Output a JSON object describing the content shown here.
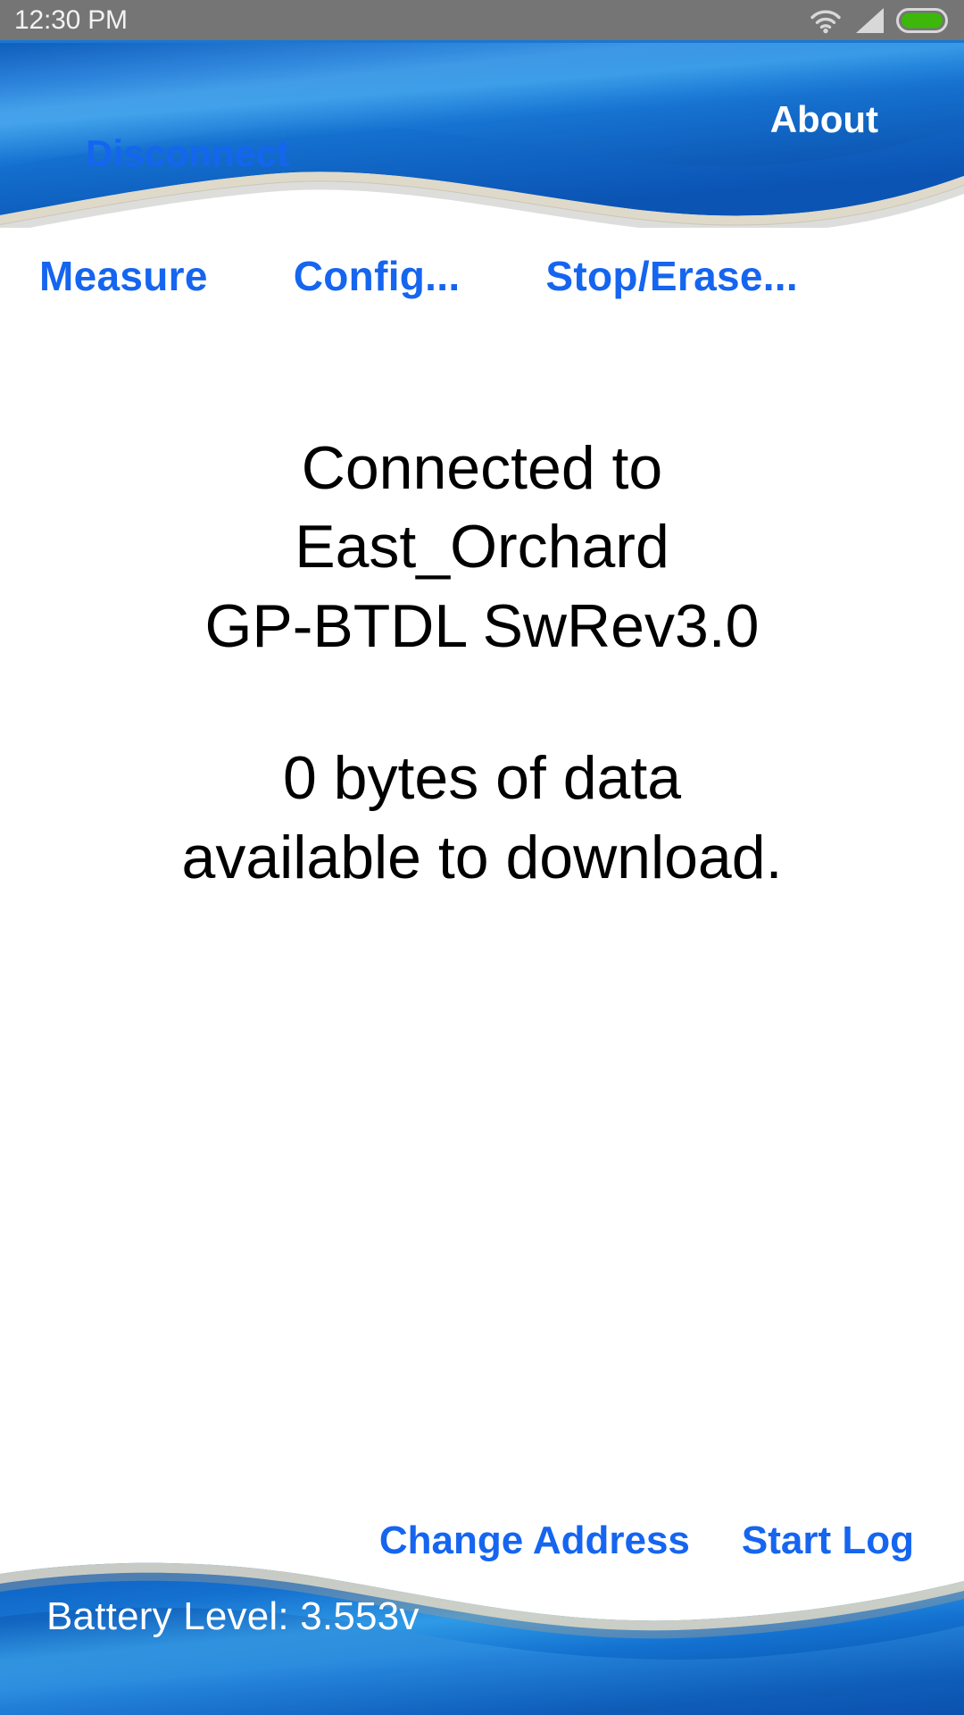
{
  "statusbar": {
    "time": "12:30 PM",
    "icons": [
      "wifi-icon",
      "cellular-signal-icon",
      "battery-icon"
    ],
    "battery_color": "#3cb70a",
    "background": "#757575"
  },
  "header": {
    "disconnect_label": "Disconnect",
    "about_label": "About",
    "accent_blue": "#1565f0",
    "wave_blue_dark": "#0a4fa8",
    "wave_blue_mid": "#0b63c9",
    "wave_blue_light": "#3aa0ea",
    "wave_edge": "#d9d2bf"
  },
  "nav": {
    "items": [
      {
        "label": "Measure"
      },
      {
        "label": "Config..."
      },
      {
        "label": "Stop/Erase..."
      }
    ]
  },
  "main": {
    "lines": [
      "Connected to",
      "East_Orchard",
      "GP-BTDL SwRev3.0"
    ],
    "lines2": [
      "0 bytes of data",
      "available to download."
    ]
  },
  "bottom": {
    "change_address_label": "Change Address",
    "start_log_label": "Start Log"
  },
  "footer": {
    "battery_text": "Battery Level: 3.553v"
  }
}
